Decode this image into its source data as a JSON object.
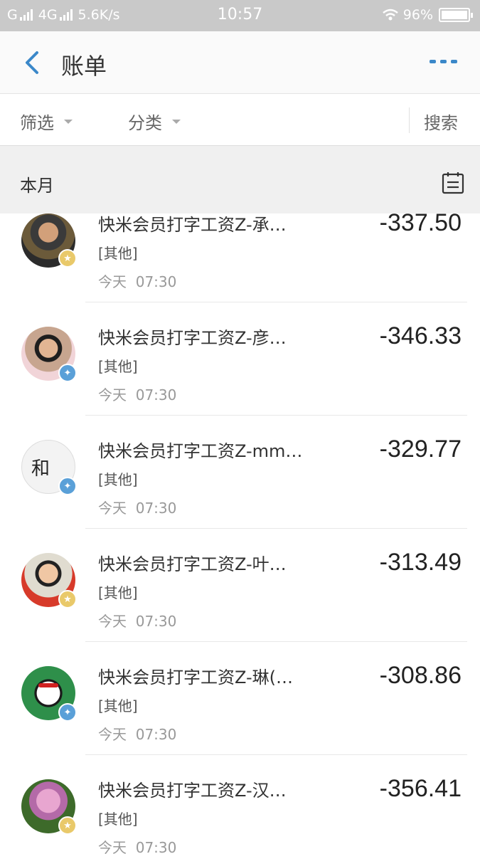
{
  "status": {
    "carrier1": "G",
    "carrier2": "4G",
    "speed": "5.6K/s",
    "time": "10:57",
    "battery": "96%",
    "wifi_icon": "wifi-icon"
  },
  "header": {
    "title": "账单",
    "back_icon": "chevron-left-icon",
    "more_icon": "more-icon",
    "accent": "#3b88c9"
  },
  "filters": {
    "filter_label": "筛选",
    "category_label": "分类",
    "search_label": "搜索"
  },
  "month": {
    "label": "本月",
    "icon": "calendar-list-icon"
  },
  "items": [
    {
      "title": "快米会员打字工资Z-承…",
      "category": "[其他]",
      "day": "今天",
      "time": "07:30",
      "amount": "-337.50"
    },
    {
      "title": "快米会员打字工资Z-彦…",
      "category": "[其他]",
      "day": "今天",
      "time": "07:30",
      "amount": "-346.33"
    },
    {
      "title": "快米会员打字工资Z-mm…",
      "category": "[其他]",
      "day": "今天",
      "time": "07:30",
      "amount": "-329.77"
    },
    {
      "title": "快米会员打字工资Z-叶…",
      "category": "[其他]",
      "day": "今天",
      "time": "07:30",
      "amount": "-313.49"
    },
    {
      "title": "快米会员打字工资Z-琳(…",
      "category": "[其他]",
      "day": "今天",
      "time": "07:30",
      "amount": "-308.86"
    },
    {
      "title": "快米会员打字工资Z-汉…",
      "category": "[其他]",
      "day": "今天",
      "time": "07:30",
      "amount": "-356.41"
    }
  ]
}
